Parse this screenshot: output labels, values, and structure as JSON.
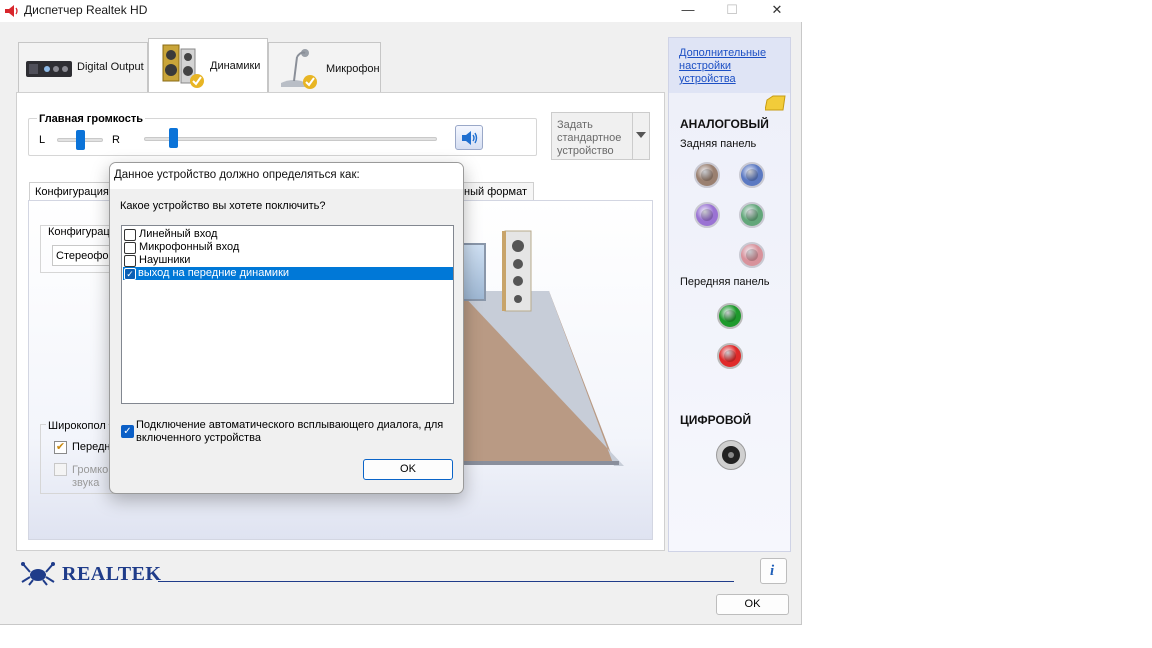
{
  "window": {
    "title": "Диспетчер Realtek HD",
    "minimize_glyph": "—",
    "maximize_glyph": "☐",
    "close_glyph": "✕"
  },
  "tabs": [
    {
      "label": "Digital Output",
      "icon": "digital-output-icon"
    },
    {
      "label": "Динамики",
      "icon": "speakers-icon"
    },
    {
      "label": "Микрофон",
      "icon": "microphone-icon"
    }
  ],
  "volume": {
    "title": "Главная громкость",
    "left_label": "L",
    "right_label": "R",
    "balance": 0.5,
    "level": 0.1
  },
  "default_device": {
    "label": "Задать стандартное устройство"
  },
  "background_panel": {
    "config_tab": "Конфигурация",
    "format_tab_fragment": "тный формат",
    "config_label_fragment": "Конфигурац",
    "config_select_fragment": "Стереофо",
    "fullrange_fragment": "Широкопол",
    "front_fragment": "Передн",
    "virtual_fragment_1": "Громко",
    "virtual_fragment_2": "звука"
  },
  "right_panel": {
    "link": "Дополнительные настройки устройства",
    "analog_header": "АНАЛОГОВЫЙ",
    "rear_panel": "Задняя панель",
    "front_panel": "Передняя панель",
    "digital_header": "ЦИФРОВОЙ",
    "jack_colors": {
      "grey": "#9a8070",
      "blue": "#5b79c2",
      "purple": "#9a73d3",
      "green": "#63a77a",
      "pink": "#d8929b",
      "front_green": "#1e9a2c",
      "front_red": "#e02a2a"
    }
  },
  "bottom": {
    "brand": "REALTEK",
    "info_glyph": "i",
    "ok_label": "OK"
  },
  "dialog": {
    "title": "Данное устройство должно определяться как:",
    "question": "Какое устройство вы хотете поключить?",
    "items": [
      {
        "label": "Линейный вход",
        "checked": false
      },
      {
        "label": "Микрофонный вход",
        "checked": false
      },
      {
        "label": "Наушники",
        "checked": false
      },
      {
        "label": "выход на передние динамики",
        "checked": true
      }
    ],
    "auto_popup_label": "Подключение автоматического всплывающего диалога, для включенного устройства",
    "auto_popup_checked": true,
    "ok_label": "OK"
  }
}
